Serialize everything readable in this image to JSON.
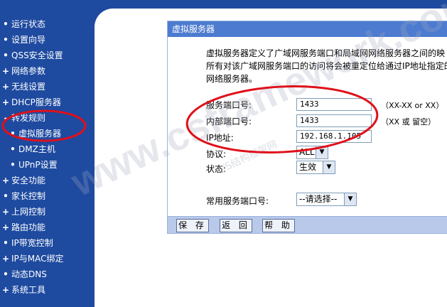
{
  "sidebar": {
    "items": [
      {
        "marker": "•",
        "label": "运行状态"
      },
      {
        "marker": "•",
        "label": "设置向导"
      },
      {
        "marker": "•",
        "label": "QSS安全设置"
      },
      {
        "marker": "+",
        "label": "网络参数"
      },
      {
        "marker": "+",
        "label": "无线设置"
      },
      {
        "marker": "+",
        "label": "DHCP服务器"
      },
      {
        "marker": "-",
        "label": "转发规则"
      },
      {
        "marker": "•",
        "label": "虚拟服务器"
      },
      {
        "marker": "•",
        "label": "DMZ主机"
      },
      {
        "marker": "•",
        "label": "UPnP设置"
      },
      {
        "marker": "+",
        "label": "安全功能"
      },
      {
        "marker": "•",
        "label": "家长控制"
      },
      {
        "marker": "+",
        "label": "上网控制"
      },
      {
        "marker": "+",
        "label": "路由功能"
      },
      {
        "marker": "•",
        "label": "IP带宽控制"
      },
      {
        "marker": "+",
        "label": "IP与MAC绑定"
      },
      {
        "marker": "•",
        "label": "动态DNS"
      },
      {
        "marker": "+",
        "label": "系统工具"
      }
    ]
  },
  "panel": {
    "title": "虚拟服务器",
    "desc": [
      "虚拟服务器定义了广域网服务端口和局域网网络服务器之间的映",
      "所有对该广域网服务端口的访问将会被重定位给通过IP地址指定的",
      "网络服务器。"
    ],
    "service_port_label": "服务端口号:",
    "service_port_value": "1433",
    "service_port_hint": "（XX-XX or XX）",
    "internal_port_label": "内部端口号:",
    "internal_port_value": "1433",
    "internal_port_hint": "（XX 或 留空）",
    "ip_label": "IP地址:",
    "ip_value": "192.168.1.105",
    "protocol_label": "协议:",
    "protocol_value": "ALL",
    "status_label": "状态:",
    "status_value": "生效",
    "common_port_label": "常用服务端口号:",
    "common_port_value": "--请选择--"
  },
  "buttons": {
    "save": "保 存",
    "back": "返 回",
    "help": "帮 助"
  },
  "watermark": {
    "text": "www.csframework.com",
    "cn": "C/S结构框架网"
  },
  "colors": {
    "sidebar": "#1e4aa0",
    "title_bar": "#4c7bd0",
    "annotation": "#e0101a"
  }
}
